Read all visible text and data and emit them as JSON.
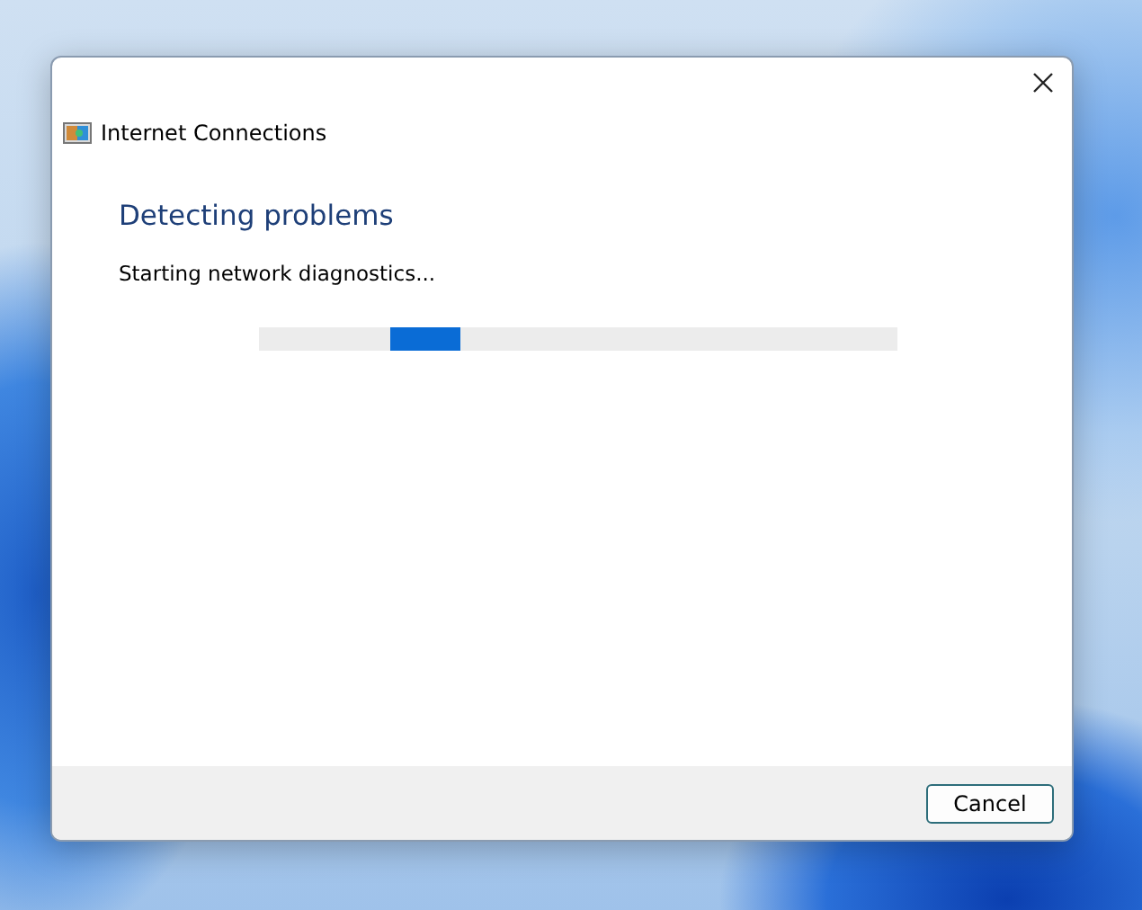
{
  "window": {
    "title": "Internet Connections"
  },
  "heading": "Detecting problems",
  "status": "Starting network diagnostics...",
  "buttons": [
    "Cancel"
  ]
}
